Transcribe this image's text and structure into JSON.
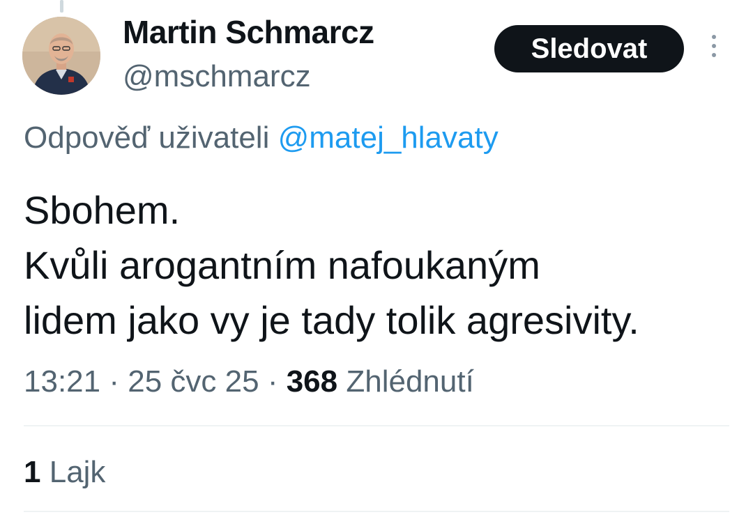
{
  "author": {
    "display_name": "Martin Schmarcz",
    "handle": "@mschmarcz",
    "avatar_icon": "profile-photo"
  },
  "header": {
    "follow_label": "Sledovat",
    "more_icon": "more-vertical-icon"
  },
  "reply": {
    "prefix": "Odpověď uživateli",
    "mention": "@matej_hlavaty"
  },
  "tweet": {
    "lines": [
      "Sbohem.",
      "Kvůli arogantním nafoukaným",
      "lidem jako vy je tady tolik agresivity."
    ]
  },
  "meta": {
    "time": "13:21",
    "separator": "·",
    "date": "25 čvc 25",
    "views_count": "368",
    "views_label": "Zhlédnutí"
  },
  "engagement": {
    "likes_count": "1",
    "likes_label": "Lajk"
  },
  "colors": {
    "text": "#0f1419",
    "secondary": "#536471",
    "link": "#1d9bf0",
    "button_bg": "#0f1419",
    "divider": "#eff3f4"
  }
}
